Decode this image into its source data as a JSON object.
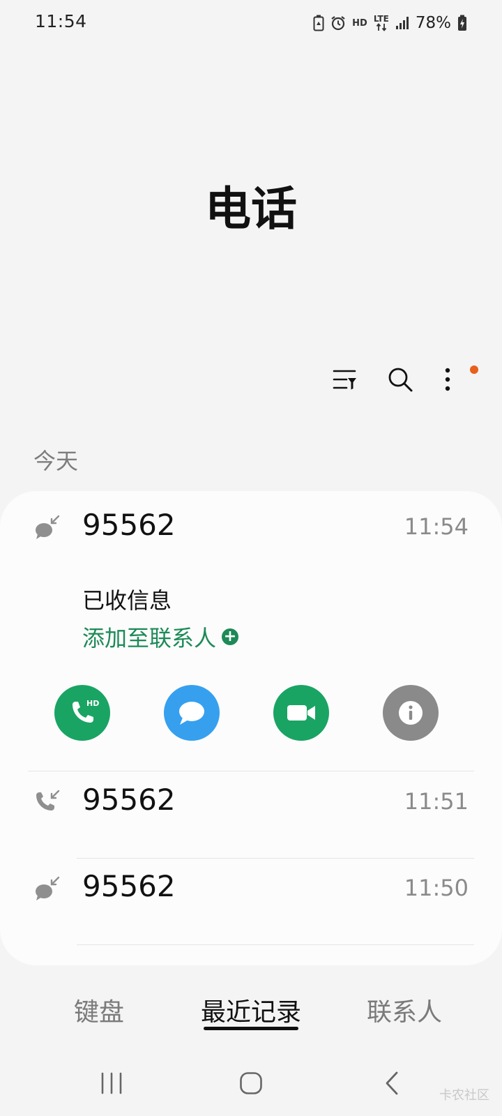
{
  "status_bar": {
    "time": "11:54",
    "hd_label": "HD",
    "lte_label": "LTE",
    "battery_percent": "78%",
    "icons": [
      "battery-saver-icon",
      "alarm-icon",
      "hd-voice-icon",
      "lte-data-icon",
      "signal-icon",
      "battery-charging-icon"
    ]
  },
  "header": {
    "title": "电话"
  },
  "toolbar": {
    "icons": [
      "filter-icon",
      "search-icon",
      "more-options-icon"
    ],
    "has_notification_dot": true,
    "notification_color": "#e8601c"
  },
  "recents": {
    "section_label": "今天",
    "expanded": {
      "number": "95562",
      "time": "11:54",
      "type_icon": "message-received-icon",
      "status": "已收信息",
      "add_contact_label": "添加至联系人",
      "actions": [
        {
          "name": "hd-call-button",
          "icon": "phone-hd-icon",
          "badge": "HD",
          "color": "#19a463"
        },
        {
          "name": "message-button",
          "icon": "chat-bubble-icon",
          "color": "#36a0ef"
        },
        {
          "name": "video-call-button",
          "icon": "video-camera-icon",
          "color": "#19a463"
        },
        {
          "name": "details-button",
          "icon": "info-icon",
          "color": "#8a8a8a"
        }
      ]
    },
    "items": [
      {
        "number": "95562",
        "time": "11:51",
        "type_icon": "incoming-call-icon"
      },
      {
        "number": "95562",
        "time": "11:50",
        "type_icon": "message-received-icon"
      }
    ]
  },
  "bottom_tabs": [
    {
      "label": "键盘",
      "active": false
    },
    {
      "label": "最近记录",
      "active": true
    },
    {
      "label": "联系人",
      "active": false
    }
  ],
  "nav_bar": {
    "icons": [
      "recent-apps-icon",
      "home-icon",
      "back-icon"
    ]
  },
  "watermark": "卡农社区",
  "colors": {
    "accent_green": "#1d8a57",
    "background": "#f4f4f4",
    "card": "#fcfcfc"
  }
}
